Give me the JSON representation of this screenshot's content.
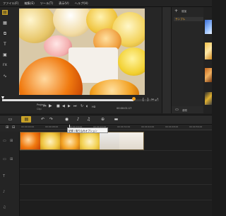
{
  "menu": {
    "items": [
      "ファイル(F)",
      "編集(E)",
      "ツール(T)",
      "表示(V)",
      "ヘルプ(H)"
    ]
  },
  "preview": {
    "project_label": "Project",
    "clip_label": "Clip",
    "timecode": "00:00:01:17",
    "controls": {
      "prev": "⏮",
      "play": "▶",
      "next": "⏭",
      "repeat": "↻",
      "volume": "🔊",
      "hd": "HD"
    }
  },
  "library": {
    "import_label": "追加",
    "sample_label": "サンプル",
    "browse_label": "参照"
  },
  "tooltip": {
    "text": "記録 / 取り込みオプション"
  },
  "ruler": {
    "ticks": [
      "00:00:00:00",
      "00:00:08:00",
      "00:00:16:00",
      "00:00:24:00",
      "00:00:32:00",
      "00:00:40:00",
      "00:00:48:00",
      "00:00:56:00"
    ]
  },
  "colors": {
    "accent": "#e8a532",
    "playhead": "#f0a020"
  }
}
